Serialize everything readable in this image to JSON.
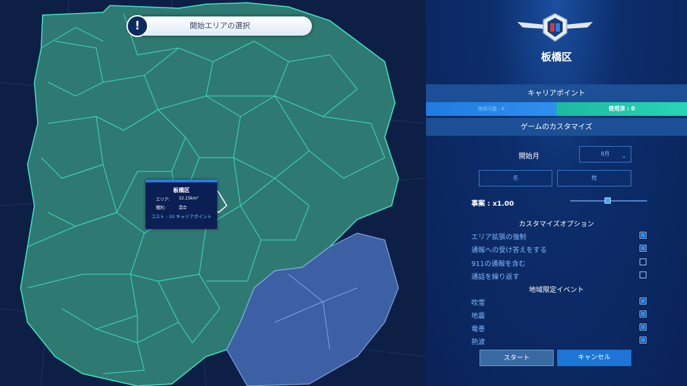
{
  "header": {
    "banner_text": "開始エリアの選択",
    "banner_icon": "exclamation-icon"
  },
  "tooltip": {
    "title": "板橋区",
    "area_label": "エリア:",
    "area_value": "32.15km²",
    "type_label": "種別:",
    "type_value": "混合",
    "cost_text": "コスト : 10 キャリアポイント"
  },
  "panel": {
    "emblem": "winged-shield-emblem-icon",
    "district_name": "板橋区",
    "career_points_title": "キャリアポイント",
    "points_available": "使用可能 : 6",
    "points_used": "使用済 : 0",
    "customize_title": "ゲームのカスタマイズ",
    "start_month_label": "開始月",
    "start_month_value": "8月",
    "first_name_placeholder": "名",
    "last_name_placeholder": "姓",
    "case_label": "事案 : x1.00",
    "case_multiplier": 1.0,
    "options_title": "カスタマイズオプション",
    "options": [
      {
        "label": "エリア拡張の強制",
        "checked": true
      },
      {
        "label": "通報への受け答えをする",
        "checked": true
      },
      {
        "label": "911の通報を含む",
        "checked": false
      },
      {
        "label": "通話を繰り返す",
        "checked": false
      }
    ],
    "events_title": "地域限定イベント",
    "events": [
      {
        "label": "吹雪",
        "checked": true
      },
      {
        "label": "地震",
        "checked": true
      },
      {
        "label": "竜巻",
        "checked": true
      },
      {
        "label": "熱波",
        "checked": true
      }
    ],
    "start_button": "スタート",
    "cancel_button": "キャンセル"
  },
  "colors": {
    "map_bg": "#0e1f45",
    "region_fill": "#2e7a72",
    "region_stroke": "#3fe8c8",
    "bay_fill": "#3d5fa3",
    "accent": "#1d75d6"
  }
}
